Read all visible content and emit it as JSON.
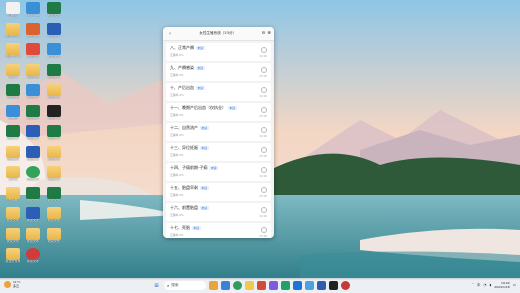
{
  "desktop": {
    "icons": [
      {
        "label": "回收站",
        "type": "white"
      },
      {
        "label": "新建文件夹",
        "type": "folder"
      },
      {
        "label": "新建文件夹",
        "type": "folder"
      },
      {
        "label": "文件夹",
        "type": "folder"
      },
      {
        "label": "新建表格",
        "type": "excel"
      },
      {
        "label": "此电脑",
        "type": "blue"
      },
      {
        "label": "新建文件",
        "type": "excel"
      },
      {
        "label": "新建文件",
        "type": "folder"
      },
      {
        "label": "文件夹",
        "type": "folder"
      },
      {
        "label": "文件夹",
        "type": "folder"
      },
      {
        "label": "新建文件",
        "type": "folder"
      },
      {
        "label": "新建文件",
        "type": "folder"
      },
      {
        "label": "新建文件夹",
        "type": "folder"
      },
      {
        "label": "Windows",
        "type": "blue"
      },
      {
        "label": "新建文件",
        "type": "ppt"
      },
      {
        "label": "新建文件",
        "type": "pdf"
      },
      {
        "label": "新建文件",
        "type": "folder"
      },
      {
        "label": "新建文件",
        "type": "blue"
      },
      {
        "label": "新建文件",
        "type": "excel"
      },
      {
        "label": "新建文件",
        "type": "word"
      },
      {
        "label": "新建文件",
        "type": "word"
      },
      {
        "label": "新建文件",
        "type": "green"
      },
      {
        "label": "新建文件",
        "type": "excel"
      },
      {
        "label": "新建文件",
        "type": "word"
      },
      {
        "label": "新建文件",
        "type": "folder"
      },
      {
        "label": "新建文件",
        "type": "red"
      },
      {
        "label": "新建文件",
        "type": "excel"
      },
      {
        "label": "新建文件",
        "type": "word"
      },
      {
        "label": "新建文件",
        "type": "blue"
      },
      {
        "label": "新建文件",
        "type": "excel"
      },
      {
        "label": "新建文件",
        "type": "folder"
      },
      {
        "label": "新建文件",
        "type": "dark"
      },
      {
        "label": "新建文件",
        "type": "excel"
      },
      {
        "label": "新建文件",
        "type": "folder"
      },
      {
        "label": "新建文件",
        "type": "folder"
      },
      {
        "label": "新建文件",
        "type": "excel"
      },
      {
        "label": "新建文件",
        "type": "folder"
      },
      {
        "label": "新建文件",
        "type": "folder"
      }
    ]
  },
  "panel": {
    "back_icon": "chevron-left-icon",
    "title": "女性生殖系统（53分）",
    "more_icon": "more-icon",
    "close_icon": "close-icon",
    "items": [
      {
        "name": "八、正常产褥",
        "tag": "未读",
        "progress": "正确率 0%",
        "time": "00:00"
      },
      {
        "name": "九、产褥感染",
        "tag": "未读",
        "progress": "正确率 0%",
        "time": "00:00"
      },
      {
        "name": "十、产后出血",
        "tag": "未读",
        "progress": "正确率 0%",
        "time": "00:00"
      },
      {
        "name": "十一、晚期产后出血（仅执业）",
        "tag": "未读",
        "progress": "正确率 0%",
        "time": "00:00"
      },
      {
        "name": "十二、自然流产",
        "tag": "未读",
        "progress": "正确率 0%",
        "time": "00:00"
      },
      {
        "name": "十三、异位妊娠",
        "tag": "未读",
        "progress": "正确率 0%",
        "time": "00:00"
      },
      {
        "name": "十四、子痫前期-子痫",
        "tag": "未读",
        "progress": "正确率 0%",
        "time": "00:00"
      },
      {
        "name": "十五、胎盘早剥",
        "tag": "未读",
        "progress": "正确率 0%",
        "time": "00:00"
      },
      {
        "name": "十六、前置胎盘",
        "tag": "未读",
        "progress": "正确率 0%",
        "time": "00:00"
      },
      {
        "name": "十七、死胎",
        "tag": "未读",
        "progress": "正确率 0%",
        "time": "00:00"
      }
    ]
  },
  "taskbar": {
    "weather_temp": "11°C",
    "weather_desc": "多云",
    "search_label": "搜索",
    "tray_lang": "中",
    "time": "19:04",
    "date": "2024/1/18"
  }
}
